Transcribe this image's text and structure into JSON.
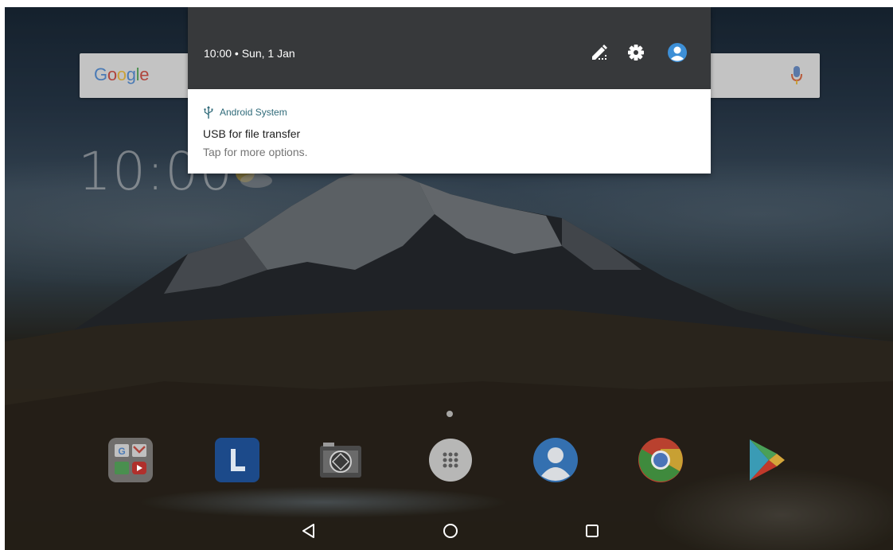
{
  "search": {
    "logo_text": "Google",
    "logo_colors": [
      "#4a7ab5",
      "#b0453c",
      "#c9a13a",
      "#4a7ab5",
      "#4a8f4f",
      "#b0453c"
    ]
  },
  "clock": {
    "text": "10:00"
  },
  "shade": {
    "header_time": "10:00 • Sun, 1 Jan",
    "icons": [
      "edit-icon",
      "settings-icon",
      "user-icon"
    ],
    "background": "#37393b"
  },
  "notification": {
    "app_name": "Android System",
    "title": "USB for file transfer",
    "text": "Tap for more options.",
    "accent": "#2f6a79"
  },
  "dock": {
    "icons": [
      "google-folder-icon",
      "lenovo-launcher-icon",
      "camera-icon",
      "app-drawer-icon",
      "contacts-icon",
      "chrome-icon",
      "play-store-icon"
    ]
  },
  "nav": {
    "buttons": [
      "back-icon",
      "home-icon",
      "recents-icon"
    ]
  }
}
